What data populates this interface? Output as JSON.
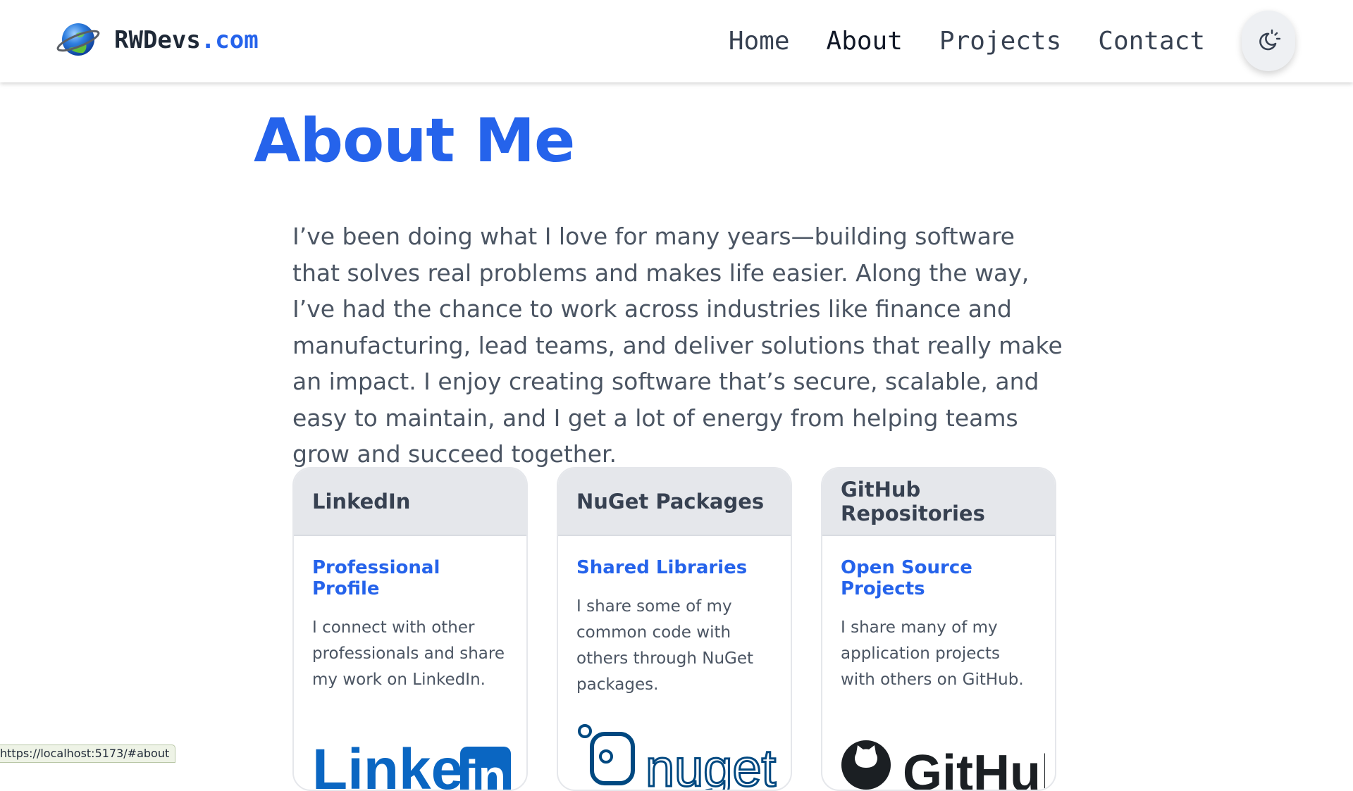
{
  "header": {
    "brand": {
      "name": "RWDevs",
      "suffix": ".com"
    },
    "nav": [
      {
        "label": "Home"
      },
      {
        "label": "About"
      },
      {
        "label": "Projects"
      },
      {
        "label": "Contact"
      }
    ],
    "active_nav": "About",
    "theme_toggle_icon": "theme-toggle-icon"
  },
  "main": {
    "title": "About Me",
    "intro": "I’ve been doing what I love for many years—building software that solves real problems and makes life easier. Along the way, I’ve had the chance to work across industries like finance and manufacturing, lead teams, and deliver solutions that really make an impact. I enjoy creating software that’s secure, scalable, and easy to maintain, and I get a lot of energy from helping teams grow and succeed together.",
    "cards": [
      {
        "header": "LinkedIn",
        "link": "Professional Profile",
        "text": "I connect with other professionals and share my work on LinkedIn.",
        "logo_text": "Linked",
        "logo_badge": "in"
      },
      {
        "header": "NuGet Packages",
        "link": "Shared Libraries",
        "text": "I share some of my common code with others through NuGet packages.",
        "logo_text": "nuget"
      },
      {
        "header": "GitHub Repositories",
        "link": "Open Source Projects",
        "text": "I share many of my application projects with others on GitHub.",
        "logo_text": "GitHub"
      }
    ]
  },
  "status_bar": {
    "url": "https://localhost:5173/#about"
  },
  "colors": {
    "accent": "#2563eb",
    "linkedin": "#0a66c2",
    "nuget": "#004880",
    "github": "#1b1f23"
  }
}
